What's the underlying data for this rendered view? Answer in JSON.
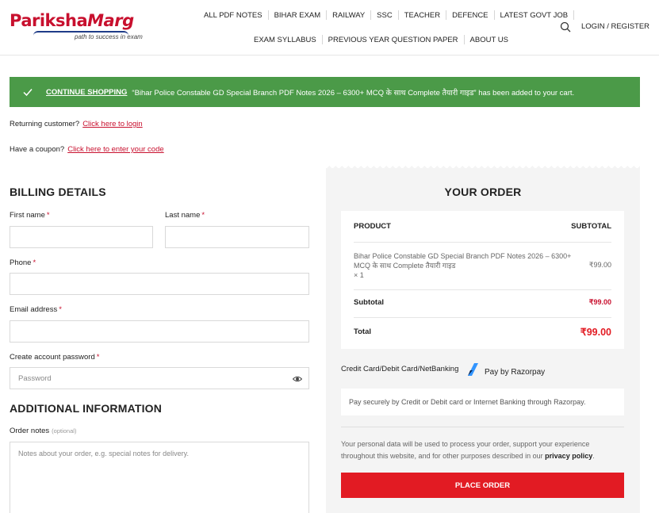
{
  "brand": {
    "name_part1": "Pariksha",
    "name_part2": "Marg",
    "tagline": "path to success in exam"
  },
  "nav": {
    "row1": [
      "ALL PDF NOTES",
      "BIHAR EXAM",
      "RAILWAY",
      "SSC",
      "TEACHER",
      "DEFENCE",
      "LATEST GOVT JOB"
    ],
    "row2": [
      "EXAM SYLLABUS",
      "PREVIOUS YEAR QUESTION PAPER",
      "ABOUT US"
    ],
    "login": "LOGIN / REGISTER"
  },
  "notice": {
    "link": "CONTINUE SHOPPING",
    "message": "“Bihar Police Constable GD Special Branch PDF Notes 2026 – 6300+ MCQ के साथ Complete तैयारी गाइड” has been added to your cart."
  },
  "returning": {
    "text": "Returning customer?",
    "link": "Click here to login"
  },
  "coupon": {
    "text": "Have a coupon?",
    "link": "Click here to enter your code"
  },
  "billing": {
    "title": "BILLING DETAILS",
    "first_name": "First name",
    "last_name": "Last name",
    "phone": "Phone",
    "email": "Email address",
    "password": "Create account password",
    "password_placeholder": "Password",
    "required_mark": "*"
  },
  "additional": {
    "title": "ADDITIONAL INFORMATION",
    "notes_label": "Order notes",
    "notes_optional": "(optional)",
    "notes_placeholder": "Notes about your order, e.g. special notes for delivery."
  },
  "order": {
    "title": "YOUR ORDER",
    "col_product": "PRODUCT",
    "col_subtotal": "SUBTOTAL",
    "item_name": "Bihar Police Constable GD Special Branch PDF Notes 2026 – 6300+ MCQ के साथ Complete तैयारी गाइड",
    "item_qty": "× 1",
    "item_price": "₹99.00",
    "subtotal_label": "Subtotal",
    "subtotal_value": "₹99.00",
    "total_label": "Total",
    "total_value": "₹99.00"
  },
  "payment": {
    "method": "Credit Card/Debit Card/NetBanking",
    "provider": "Pay by Razorpay",
    "description": "Pay securely by Credit or Debit card or Internet Banking through Razorpay."
  },
  "privacy": {
    "text": "Your personal data will be used to process your order, support your experience throughout this website, and for other purposes described in our",
    "link": "privacy policy",
    "end": "."
  },
  "place_order": "PLACE ORDER",
  "colors": {
    "accent": "#e21b23",
    "success": "#4b9a48",
    "brand_red": "#c8102e"
  }
}
